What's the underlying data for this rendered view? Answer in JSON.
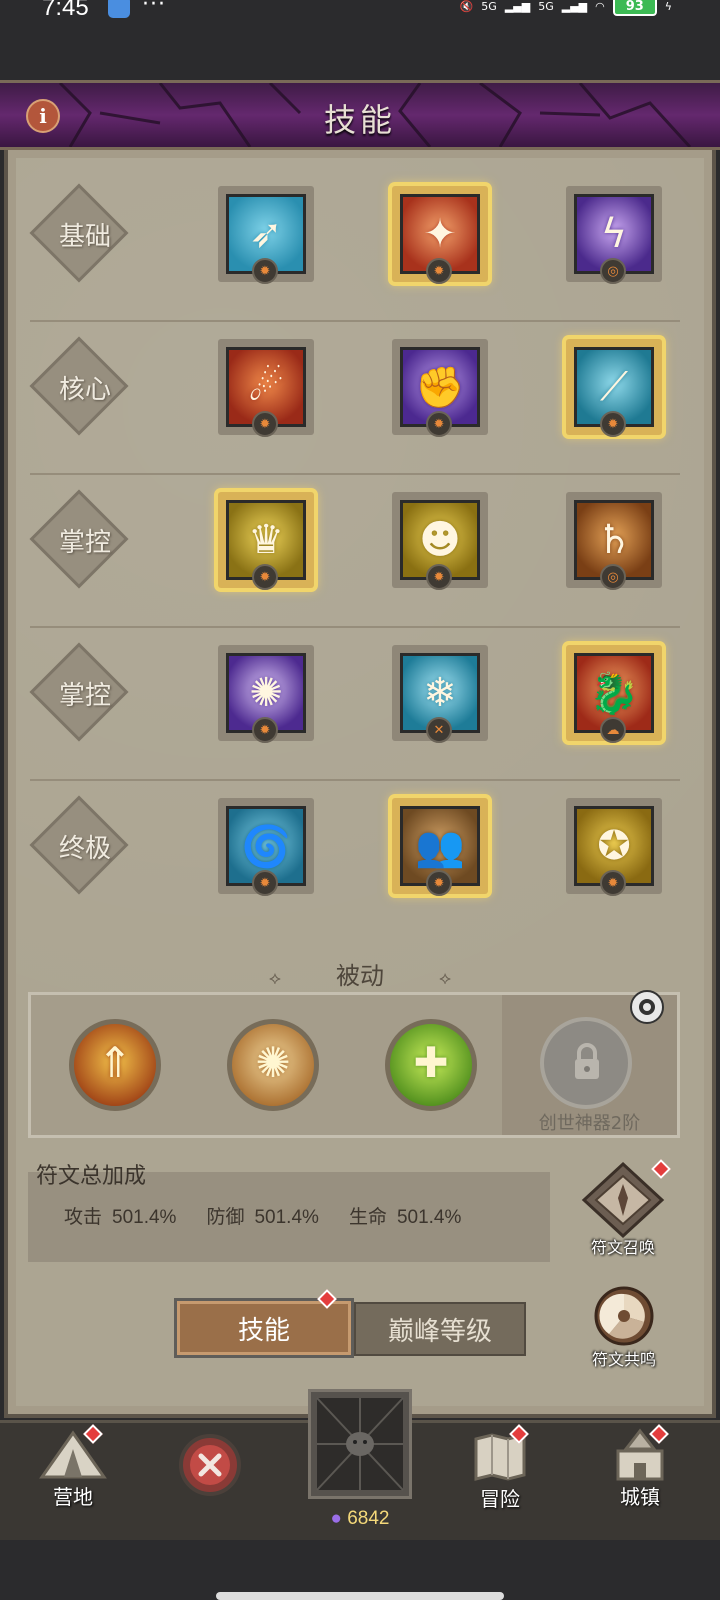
{
  "status_bar": {
    "time": "7:45",
    "dots": "···",
    "battery": "93",
    "net1": "5G",
    "net2": "5G"
  },
  "header": {
    "title": "技能",
    "info_label": "i"
  },
  "skill_rows": [
    {
      "label": "基础",
      "skills": [
        {
          "name": "ice-arrow-skill",
          "colors": [
            "#2a8fb0",
            "#7fd2e8"
          ],
          "glyph": "➶",
          "selected": false,
          "rune": "✹"
        },
        {
          "name": "fire-slash-skill",
          "colors": [
            "#a8321c",
            "#f2a06a"
          ],
          "glyph": "✦",
          "selected": true,
          "rune": "✹"
        },
        {
          "name": "lightning-bolt-skill",
          "colors": [
            "#4b2a8c",
            "#c8a6f0"
          ],
          "glyph": "ϟ",
          "selected": false,
          "rune": "◎"
        }
      ]
    },
    {
      "label": "核心",
      "skills": [
        {
          "name": "fireball-skill",
          "colors": [
            "#9a2a18",
            "#f08a4a"
          ],
          "glyph": "☄",
          "selected": false,
          "rune": "✹"
        },
        {
          "name": "thunder-fist-skill",
          "colors": [
            "#4c2990",
            "#b99ae8"
          ],
          "glyph": "✊",
          "selected": false,
          "rune": "✹"
        },
        {
          "name": "ice-shards-skill",
          "colors": [
            "#1f7a93",
            "#8fd9ea"
          ],
          "glyph": "⟋",
          "selected": true,
          "rune": "✹"
        }
      ]
    },
    {
      "label": "掌控",
      "skills": [
        {
          "name": "golden-crown-skill",
          "colors": [
            "#8a7215",
            "#eed45a"
          ],
          "glyph": "♛",
          "selected": true,
          "rune": "✹"
        },
        {
          "name": "golden-spirit-skill",
          "colors": [
            "#8a7012",
            "#e8cd52"
          ],
          "glyph": "☻",
          "selected": false,
          "rune": "✹"
        },
        {
          "name": "planet-orbit-skill",
          "colors": [
            "#7a3f15",
            "#e4a257"
          ],
          "glyph": "♄",
          "selected": false,
          "rune": "◎"
        }
      ]
    },
    {
      "label": "掌控",
      "skills": [
        {
          "name": "electric-orb-skill",
          "colors": [
            "#4d2a90",
            "#d7c1f4"
          ],
          "glyph": "✺",
          "selected": false,
          "rune": "✹"
        },
        {
          "name": "frost-nova-skill",
          "colors": [
            "#1e7c98",
            "#9fe0f0"
          ],
          "glyph": "❄",
          "selected": false,
          "rune": "✕"
        },
        {
          "name": "fire-dragon-skill",
          "colors": [
            "#9e2a18",
            "#f0a062"
          ],
          "glyph": "🐉",
          "selected": true,
          "rune": "☁"
        }
      ]
    },
    {
      "label": "终极",
      "skills": [
        {
          "name": "blizzard-skill",
          "colors": [
            "#1e6f8e",
            "#7ccde4"
          ],
          "glyph": "🌀",
          "selected": false,
          "rune": "✹"
        },
        {
          "name": "summon-allies-skill",
          "colors": [
            "#6e4a22",
            "#d0a065"
          ],
          "glyph": "👥",
          "selected": true,
          "rune": "✹"
        },
        {
          "name": "golden-warrior-skill",
          "colors": [
            "#8a6a12",
            "#e8c84e"
          ],
          "glyph": "✪",
          "selected": false,
          "rune": "✹"
        }
      ]
    }
  ],
  "passive": {
    "title": "被动",
    "ornament": "⟡",
    "slots": [
      {
        "name": "fire-arrow-passive",
        "colors": [
          "#9b3b13",
          "#f2c14a"
        ],
        "glyph": "⇑"
      },
      {
        "name": "golden-orb-passive",
        "colors": [
          "#a76a2a",
          "#f0d59a"
        ],
        "glyph": "✺"
      },
      {
        "name": "heal-heart-passive",
        "colors": [
          "#4a8a1a",
          "#c8ec5a"
        ],
        "glyph": "✚"
      }
    ],
    "locked_text": "创世神器2阶"
  },
  "rune_bonus": {
    "title": "符文总加成",
    "stats": [
      {
        "label": "攻击",
        "value": "501.4%"
      },
      {
        "label": "防御",
        "value": "501.4%"
      },
      {
        "label": "生命",
        "value": "501.4%"
      }
    ]
  },
  "side_buttons": {
    "summon": "符文召唤",
    "resonance": "符文共鸣"
  },
  "tabs": {
    "active": "技能",
    "inactive": "巅峰等级"
  },
  "nav": {
    "camp": "营地",
    "adventure": "冒险",
    "town": "城镇",
    "currency": "6842"
  },
  "colors": {
    "header_purple": "#64286e",
    "selected_gold": "#f1d56b",
    "red_dot": "#e43d3d"
  }
}
